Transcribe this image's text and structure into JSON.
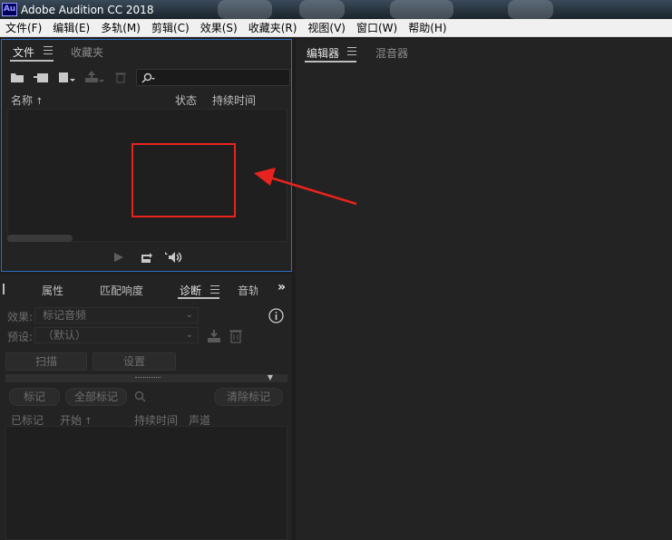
{
  "app": {
    "icon_text": "Au",
    "title": "Adobe Audition CC 2018"
  },
  "menu": [
    "文件(F)",
    "编辑(E)",
    "多轨(M)",
    "剪辑(C)",
    "效果(S)",
    "收藏夹(R)",
    "视图(V)",
    "窗口(W)",
    "帮助(H)"
  ],
  "files_panel": {
    "tabs": [
      "文件",
      "收藏夹"
    ],
    "active_tab": "文件",
    "toolbar_icons": [
      "open-folder-icon",
      "import-icon",
      "new-file-icon",
      "export-icon",
      "trash-icon",
      "search-icon"
    ],
    "search_placeholder": "",
    "columns": {
      "name": "名称",
      "status": "状态",
      "duration": "持续时间"
    }
  },
  "editor_panel": {
    "tabs": [
      "编辑器",
      "混音器"
    ],
    "active_tab": "编辑器"
  },
  "diagnostics_panel": {
    "tabs": [
      "属性",
      "匹配响度",
      "诊断",
      "音轨"
    ],
    "active_tab": "诊断",
    "effect_label": "效果:",
    "effect_value": "标记音频",
    "preset_label": "预设:",
    "preset_value": "（默认）",
    "scan_button": "扫描",
    "settings_button": "设置",
    "mark_button": "标记",
    "mark_all_button": "全部标记",
    "clear_marks_button": "清除标记",
    "columns": {
      "marked": "已标记",
      "start": "开始",
      "duration": "持续时间",
      "channel": "声道"
    }
  },
  "colors": {
    "highlight_box": "#e8231d",
    "active_panel_border": "#2e6fc2"
  }
}
